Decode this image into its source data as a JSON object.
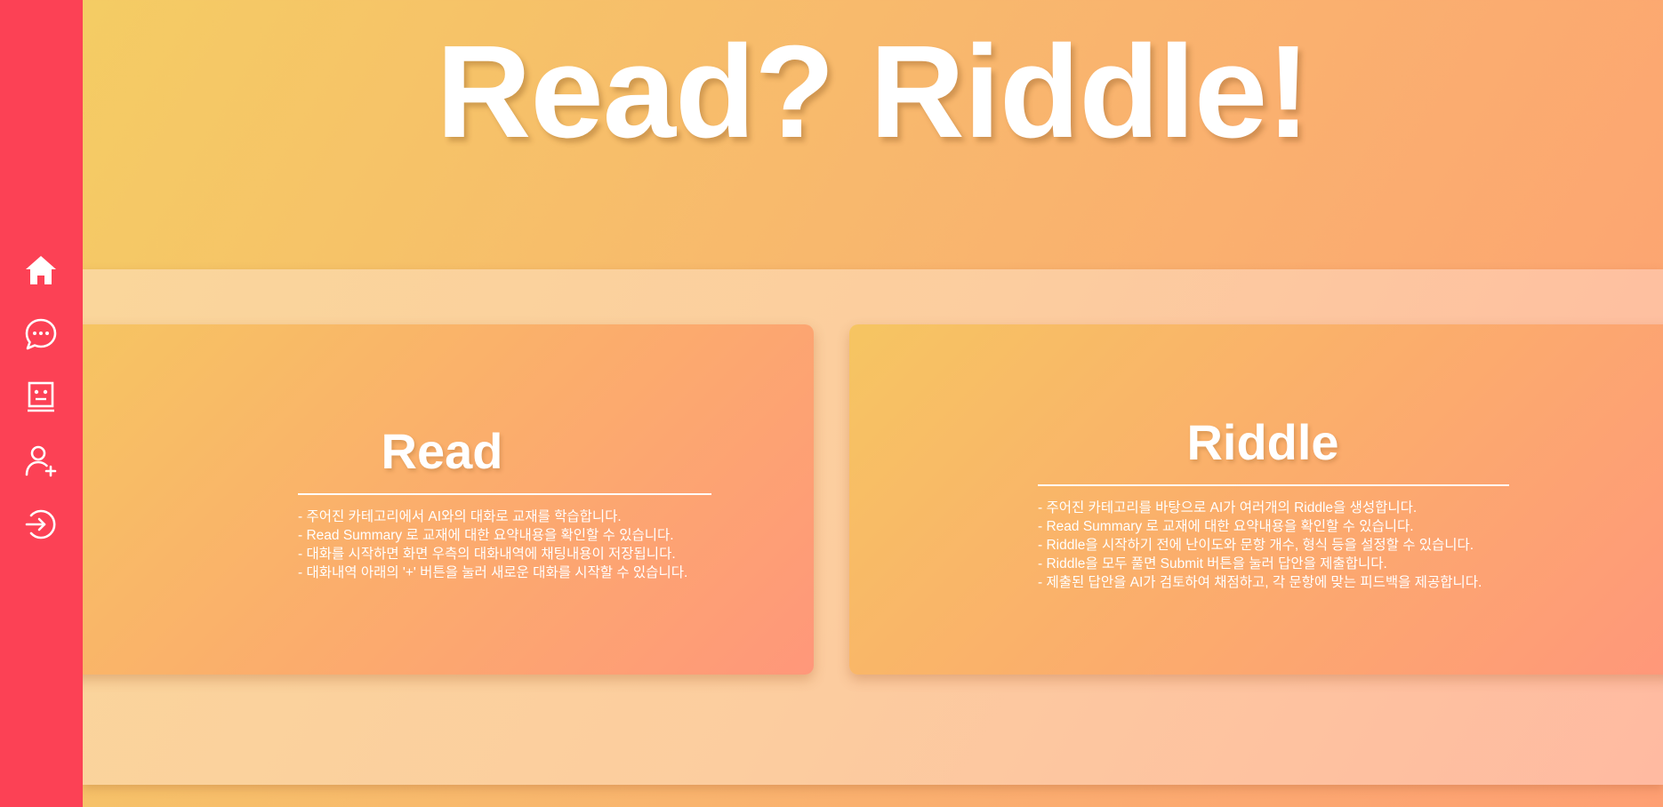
{
  "sidebar": {
    "items": [
      {
        "icon": "home-icon"
      },
      {
        "icon": "chat-bubble-icon"
      },
      {
        "icon": "robot-face-icon"
      },
      {
        "icon": "add-user-icon"
      },
      {
        "icon": "login-icon"
      }
    ]
  },
  "hero": {
    "title": "Read? Riddle!"
  },
  "cards": {
    "read": {
      "title": "Read",
      "lines": [
        "- 주어진 카테고리에서 AI와의 대화로 교재를 학습합니다.",
        "- Read Summary 로 교재에 대한 요약내용을 확인할 수 있습니다.",
        "- 대화를 시작하면 화면 우측의 대화내역에 채팅내용이 저장됩니다.",
        "- 대화내역 아래의 '+' 버튼을 눌러 새로운 대화를 시작할 수 있습니다."
      ]
    },
    "riddle": {
      "title": "Riddle",
      "lines": [
        "- 주어진 카테고리를 바탕으로 AI가 여러개의 Riddle을 생성합니다.",
        "- Read Summary 로 교재에 대한 요약내용을 확인할 수 있습니다.",
        "- Riddle을 시작하기 전에 난이도와 문항 개수, 형식 등을 설정할 수 있습니다.",
        "- Riddle을 모두 풀면 Submit 버튼을 눌러 답안을 제출합니다.",
        "- 제출된 답안을 AI가 검토하여 채점하고, 각 문항에 맞는 피드백을 제공합니다."
      ]
    }
  },
  "colors": {
    "sidebar": "#fc4155",
    "gradient_start": "#f4ce63",
    "gradient_end": "#fe9f73",
    "text": "#ffffff"
  }
}
